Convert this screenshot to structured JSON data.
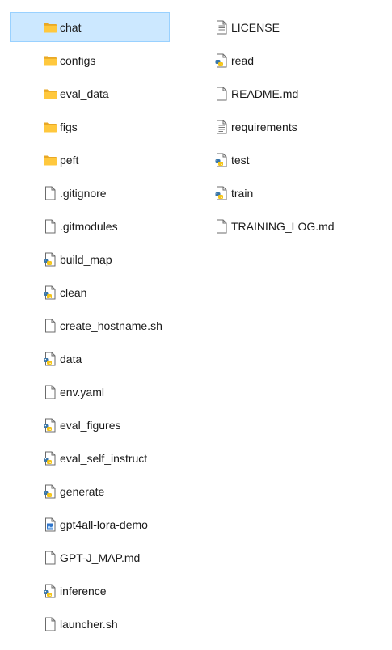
{
  "left_column": [
    {
      "name": "chat",
      "type": "folder",
      "selected": true
    },
    {
      "name": "configs",
      "type": "folder"
    },
    {
      "name": "eval_data",
      "type": "folder"
    },
    {
      "name": "figs",
      "type": "folder"
    },
    {
      "name": "peft",
      "type": "folder"
    },
    {
      "name": ".gitignore",
      "type": "file"
    },
    {
      "name": ".gitmodules",
      "type": "file"
    },
    {
      "name": "build_map",
      "type": "python"
    },
    {
      "name": "clean",
      "type": "python"
    },
    {
      "name": "create_hostname.sh",
      "type": "file"
    },
    {
      "name": "data",
      "type": "python"
    },
    {
      "name": "env.yaml",
      "type": "file"
    },
    {
      "name": "eval_figures",
      "type": "python"
    },
    {
      "name": "eval_self_instruct",
      "type": "python"
    },
    {
      "name": "generate",
      "type": "python"
    },
    {
      "name": "gpt4all-lora-demo",
      "type": "gif"
    },
    {
      "name": "GPT-J_MAP.md",
      "type": "file"
    },
    {
      "name": "inference",
      "type": "python"
    },
    {
      "name": "launcher.sh",
      "type": "file"
    }
  ],
  "right_column": [
    {
      "name": "LICENSE",
      "type": "text"
    },
    {
      "name": "read",
      "type": "python"
    },
    {
      "name": "README.md",
      "type": "file"
    },
    {
      "name": "requirements",
      "type": "text"
    },
    {
      "name": "test",
      "type": "python"
    },
    {
      "name": "train",
      "type": "python"
    },
    {
      "name": "TRAINING_LOG.md",
      "type": "file"
    }
  ],
  "colors": {
    "selection_bg": "#cce8ff",
    "selection_border": "#99d1ff",
    "folder": "#ffc83d",
    "python_blue": "#3a76a8",
    "python_yellow": "#f5c518"
  }
}
